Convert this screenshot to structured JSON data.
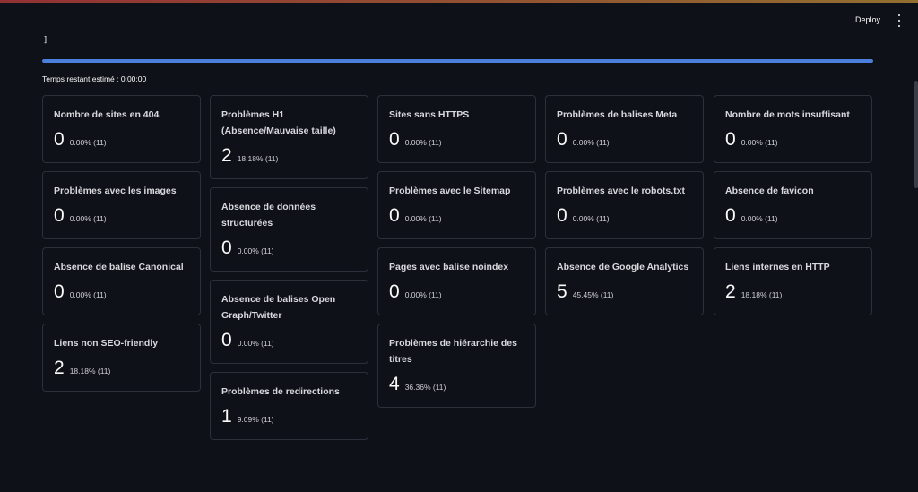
{
  "header": {
    "deploy_label": "Deploy"
  },
  "status": {
    "bracket": "]",
    "progress": 1.0,
    "eta_text": "Temps restant estimé : 0:00:00"
  },
  "columns": [
    [
      {
        "title": "Nombre de sites en 404",
        "value": "0",
        "pct": "0.00% (11)"
      },
      {
        "title": "Problèmes avec les images",
        "value": "0",
        "pct": "0.00% (11)"
      },
      {
        "title": "Absence de balise Canonical",
        "value": "0",
        "pct": "0.00% (11)"
      },
      {
        "title": "Liens non SEO-friendly",
        "value": "2",
        "pct": "18.18% (11)"
      }
    ],
    [
      {
        "title": "Problèmes H1 (Absence/Mauvaise taille)",
        "value": "2",
        "pct": "18.18% (11)"
      },
      {
        "title": "Absence de données structurées",
        "value": "0",
        "pct": "0.00% (11)"
      },
      {
        "title": "Absence de balises Open Graph/Twitter",
        "value": "0",
        "pct": "0.00% (11)"
      },
      {
        "title": "Problèmes de redirections",
        "value": "1",
        "pct": "9.09% (11)"
      }
    ],
    [
      {
        "title": "Sites sans HTTPS",
        "value": "0",
        "pct": "0.00% (11)"
      },
      {
        "title": "Problèmes avec le Sitemap",
        "value": "0",
        "pct": "0.00% (11)"
      },
      {
        "title": "Pages avec balise noindex",
        "value": "0",
        "pct": "0.00% (11)"
      },
      {
        "title": "Problèmes de hiérarchie des titres",
        "value": "4",
        "pct": "36.36% (11)"
      }
    ],
    [
      {
        "title": "Problèmes de balises Meta",
        "value": "0",
        "pct": "0.00% (11)"
      },
      {
        "title": "Problèmes avec le robots.txt",
        "value": "0",
        "pct": "0.00% (11)"
      },
      {
        "title": "Absence de Google Analytics",
        "value": "5",
        "pct": "45.45% (11)"
      }
    ],
    [
      {
        "title": "Nombre de mots insuffisant",
        "value": "0",
        "pct": "0.00% (11)"
      },
      {
        "title": "Absence de favicon",
        "value": "0",
        "pct": "0.00% (11)"
      },
      {
        "title": "Liens internes en HTTP",
        "value": "2",
        "pct": "18.18% (11)"
      }
    ]
  ]
}
